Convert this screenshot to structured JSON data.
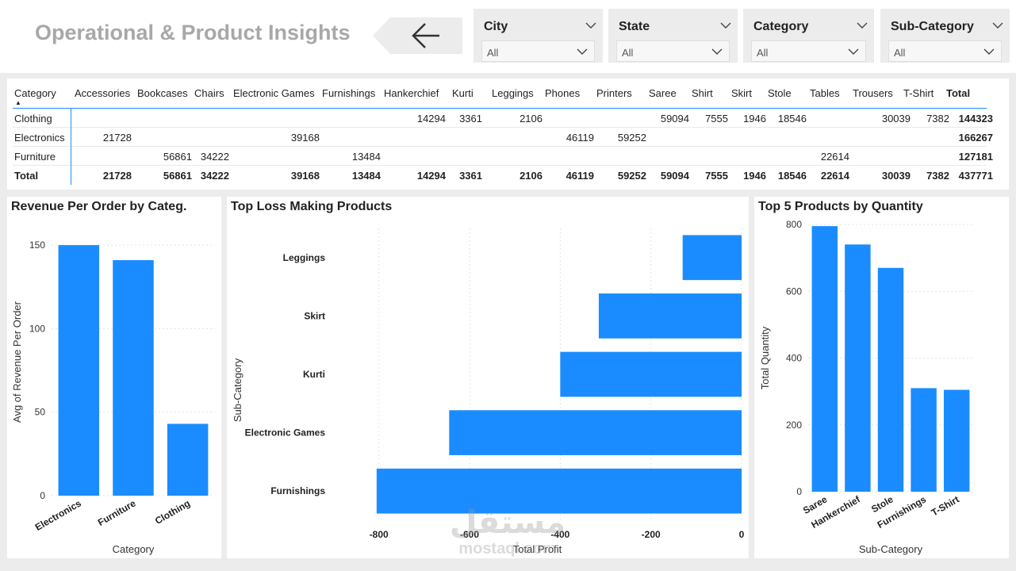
{
  "header": {
    "title": "Operational & Product Insights",
    "back_icon": "arrow-left-icon"
  },
  "slicers": [
    {
      "label": "City",
      "value": "All"
    },
    {
      "label": "State",
      "value": "All"
    },
    {
      "label": "Category",
      "value": "All"
    },
    {
      "label": "Sub-Category",
      "value": "All"
    }
  ],
  "matrix": {
    "corner": "Category",
    "columns": [
      "Accessories",
      "Bookcases",
      "Chairs",
      "Electronic Games",
      "Furnishings",
      "Hankerchief",
      "Kurti",
      "Leggings",
      "Phones",
      "Printers",
      "Saree",
      "Shirt",
      "Skirt",
      "Stole",
      "Tables",
      "Trousers",
      "T-Shirt",
      "Total"
    ],
    "rows": [
      {
        "label": "Clothing",
        "cells": [
          "",
          "",
          "",
          "",
          "",
          "14294",
          "3361",
          "2106",
          "",
          "",
          "59094",
          "7555",
          "1946",
          "18546",
          "",
          "30039",
          "7382",
          "144323"
        ]
      },
      {
        "label": "Electronics",
        "cells": [
          "21728",
          "",
          "",
          "39168",
          "",
          "",
          "",
          "",
          "46119",
          "59252",
          "",
          "",
          "",
          "",
          "",
          "",
          "",
          "166267"
        ]
      },
      {
        "label": "Furniture",
        "cells": [
          "",
          "56861",
          "34222",
          "",
          "13484",
          "",
          "",
          "",
          "",
          "",
          "",
          "",
          "",
          "",
          "22614",
          "",
          "",
          "127181"
        ]
      }
    ],
    "total": {
      "label": "Total",
      "cells": [
        "21728",
        "56861",
        "34222",
        "39168",
        "13484",
        "14294",
        "3361",
        "2106",
        "46119",
        "59252",
        "59094",
        "7555",
        "1946",
        "18546",
        "22614",
        "30039",
        "7382",
        "437771"
      ]
    }
  },
  "charts": {
    "revenue": {
      "title": "Revenue Per Order by Categ."
    },
    "loss": {
      "title": "Top Loss Making Products"
    },
    "quantity": {
      "title": "Top 5 Products by Quantity"
    }
  },
  "chart_data": [
    {
      "type": "bar",
      "title": "Revenue Per Order by Categ.",
      "xlabel": "Category",
      "ylabel": "Avg of Revenue Per Order",
      "categories": [
        "Electronics",
        "Furniture",
        "Clothing"
      ],
      "values": [
        150,
        141,
        43
      ],
      "ylim": [
        0,
        160
      ],
      "yticks": [
        0,
        50,
        100,
        150
      ],
      "grid": true,
      "color": "#1a8cff"
    },
    {
      "type": "bar",
      "orientation": "horizontal",
      "title": "Top Loss Making Products",
      "xlabel": "Total Profit",
      "ylabel": "Sub-Category",
      "categories": [
        "Leggings",
        "Skirt",
        "Kurti",
        "Electronic Games",
        "Furnishings"
      ],
      "values": [
        -130,
        -315,
        -400,
        -645,
        -805
      ],
      "xlim": [
        -810,
        0
      ],
      "xticks": [
        -800,
        -600,
        -400,
        -200,
        0
      ],
      "grid": true,
      "color": "#1a8cff"
    },
    {
      "type": "bar",
      "title": "Top 5 Products by Quantity",
      "xlabel": "Sub-Category",
      "ylabel": "Total Quantity",
      "categories": [
        "Saree",
        "Hankerchief",
        "Stole",
        "Furnishings",
        "T-Shirt"
      ],
      "values": [
        795,
        740,
        670,
        310,
        305
      ],
      "ylim": [
        0,
        800
      ],
      "yticks": [
        0,
        200,
        400,
        600,
        800
      ],
      "grid": true,
      "color": "#1a8cff"
    }
  ],
  "watermark": {
    "logo_text": "مستقل",
    "text": "mostaql.com"
  }
}
